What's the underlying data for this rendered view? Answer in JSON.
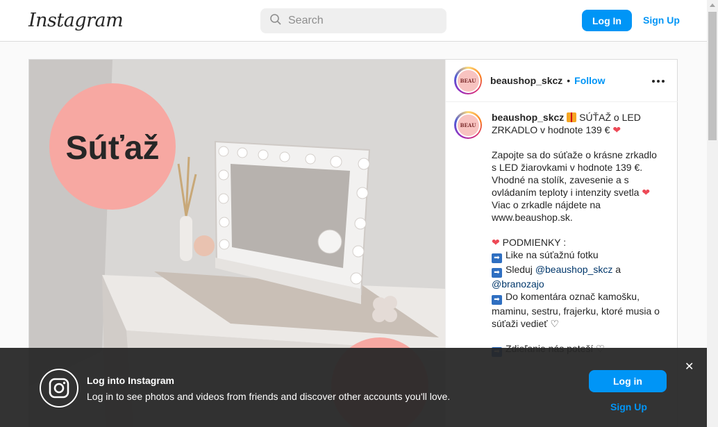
{
  "header": {
    "logo_text": "Instagram",
    "search_placeholder": "Search",
    "login_label": "Log In",
    "signup_label": "Sign Up"
  },
  "post": {
    "username": "beaushop_skcz",
    "follow_label": "Follow",
    "dot": "•",
    "avatar_text": "BEAU",
    "image_overlay_text": "Súťaž",
    "caption": {
      "username": "beaushop_skcz",
      "title_text": "SÚŤAŽ o LED ZRKADLO v hodnote 139 €",
      "p1_line1": "Zapojte sa do súťaže o krásne zrkadlo",
      "p1_line2": "s LED žiarovkami v hodnote 139 €.",
      "p1_line3": "Vhodné na stolík, zavesenie a s",
      "p1_line4": "ovládaním teploty i intenzity svetla",
      "p1_line5": "Viac o zrkadle nájdete na",
      "p1_line6": "www.beaushop.sk.",
      "conditions_title": "PODMIENKY :",
      "cond1": "Like na súťažnú fotku",
      "cond2_prefix": "Sleduj",
      "cond2_mention1": "@beaushop_skcz",
      "cond2_and": "a",
      "cond2_mention2": "@branozajo",
      "cond3": "Do komentára označ kamošku, maminu, sestru, frajerku, ktoré musia o súťaži vedieť",
      "cond4": "Zdieľanie nás poteší",
      "arrow_glyph": "➡",
      "heart_glyph": "❤",
      "heart_outline_glyph": "♡"
    }
  },
  "banner": {
    "title": "Log into Instagram",
    "text": "Log in to see photos and videos from friends and discover other accounts you'll love.",
    "login_label": "Log in",
    "signup_label": "Sign Up",
    "close_glyph": "✕"
  },
  "icons": {
    "search": "search-icon",
    "more": "more-options-icon",
    "instagram": "instagram-icon",
    "close": "close-icon"
  },
  "colors": {
    "brand_blue": "#0095f6",
    "heart_red": "#ed4956",
    "banner_bg": "#262626",
    "pink_circle": "#f7a8a2"
  }
}
